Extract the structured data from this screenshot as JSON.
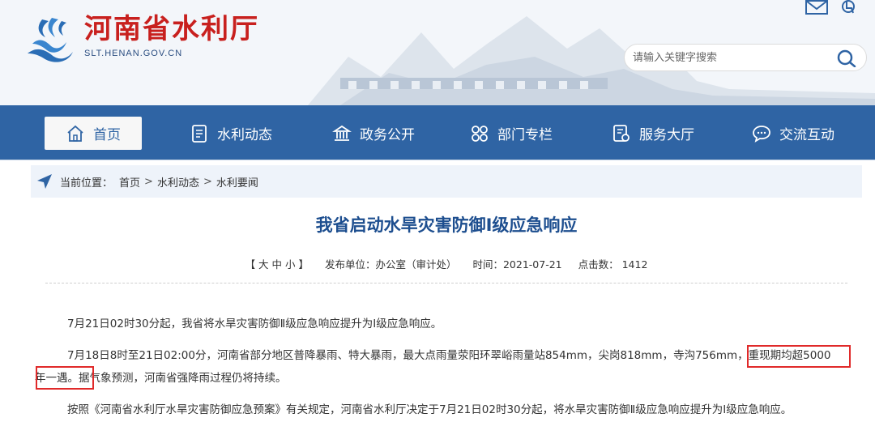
{
  "header": {
    "site_title": "河南省水利厅",
    "site_domain": "SLT.HENAN.GOV.CN",
    "search_placeholder": "请输入关键字搜索"
  },
  "nav": {
    "items": [
      {
        "label": "首页",
        "icon": "home-icon",
        "active": true
      },
      {
        "label": "水利动态",
        "icon": "document-icon",
        "active": false
      },
      {
        "label": "政务公开",
        "icon": "government-icon",
        "active": false
      },
      {
        "label": "部门专栏",
        "icon": "grid-icon",
        "active": false
      },
      {
        "label": "服务大厅",
        "icon": "service-icon",
        "active": false
      },
      {
        "label": "交流互动",
        "icon": "chat-icon",
        "active": false
      }
    ]
  },
  "breadcrumb": {
    "prefix": "当前位置：",
    "items": [
      "首页",
      "水利动态",
      "水利要闻"
    ],
    "separator": ">"
  },
  "article": {
    "title": "我省启动水旱灾害防御I级应急响应",
    "font_size_label": "【 大 中 小 】",
    "publisher": "发布单位：办公室（审计处）",
    "date": "时间：2021-07-21",
    "hits": "点击数： 1412",
    "p1": "7月21日02时30分起，我省将水旱灾害防御Ⅱ级应急响应提升为Ⅰ级应急响应。",
    "p2_line1": "7月18日8时至21日02:00分，河南省部分地区普降暴雨、特大暴雨，最大点雨量荥阳环翠峪雨量站854mm，尖岗818mm，寺沟756mm，重现期均超5000",
    "p2_line2": "年一遇。据气象预测，河南省强降雨过程仍将持续。",
    "p3": "按照《河南省水利厅水旱灾害防御应急预案》有关规定，河南省水利厅决定于7月21日02时30分起，将水旱灾害防御Ⅱ级应急响应提升为Ⅰ级应急响应。"
  },
  "colors": {
    "nav_bg": "#2f64a4",
    "title_red": "#c8201e",
    "article_title": "#1d4e8f",
    "highlight": "#e02a2a"
  }
}
